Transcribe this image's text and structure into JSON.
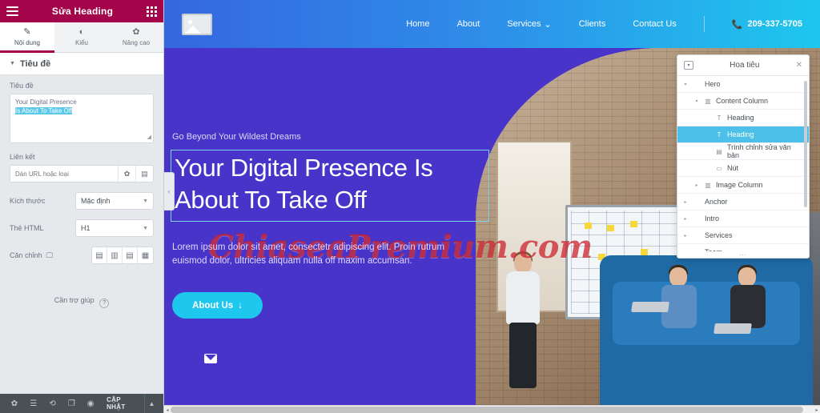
{
  "editor": {
    "header": {
      "title": "Sửa Heading",
      "menu_icon": "hamburger-icon",
      "apps_icon": "grid-icon"
    },
    "tabs": [
      {
        "label": "Nội dung",
        "icon": "pencil-icon",
        "active": true
      },
      {
        "label": "Kiểu",
        "icon": "contrast-icon",
        "active": false
      },
      {
        "label": "Nâng cao",
        "icon": "gear-icon",
        "active": false
      }
    ],
    "section": {
      "title": "Tiêu đề"
    },
    "fields": {
      "title_label": "Tiêu đề",
      "title_value_line1": "Your Digital Presence",
      "title_value_line2": "Is About To Take Off",
      "link_label": "Liên kết",
      "link_placeholder": "Dán URL hoặc loại",
      "size_label": "Kích thước",
      "size_value": "Mặc định",
      "html_tag_label": "Thẻ HTML",
      "html_tag_value": "H1",
      "align_label": "Căn chỉnh",
      "align_options": [
        "align-left",
        "align-center",
        "align-right",
        "align-justify"
      ]
    },
    "help": {
      "label": "Cần trợ giúp",
      "badge": "?"
    },
    "footer": {
      "icons": [
        "settings-icon",
        "layers-icon",
        "history-icon",
        "responsive-icon",
        "preview-eye-icon"
      ],
      "update_label": "CẬP NHẬT",
      "update_arrow": "▲"
    }
  },
  "site": {
    "logo_alt": "image-placeholder-icon",
    "nav": [
      {
        "label": "Home",
        "has_dropdown": false
      },
      {
        "label": "About",
        "has_dropdown": false
      },
      {
        "label": "Services",
        "has_dropdown": true
      },
      {
        "label": "Clients",
        "has_dropdown": false
      },
      {
        "label": "Contact Us",
        "has_dropdown": false
      }
    ],
    "phone": "209-337-5705",
    "hero": {
      "eyebrow": "Go Beyond Your Wildest Dreams",
      "heading_line1": "Your Digital Presence Is",
      "heading_line2": "About To Take Off",
      "paragraph": "Lorem ipsum dolor sit amet, consectetr adipiscing elit. Proin rutrum euismod dolor, ultricies aliquam nulla off  maxim accumsan.",
      "cta_label": "About Us",
      "cta_arrow": "↓",
      "mail_icon": "envelope-icon"
    },
    "watermark": "ChiaseaPremium.com"
  },
  "navigator": {
    "title": "Hoa tiêu",
    "dock_icon": "dock-icon",
    "close_icon": "close-icon",
    "items": [
      {
        "label": "Hero",
        "depth": 0,
        "icon": "",
        "arrow": "▾",
        "selected": false
      },
      {
        "label": "Content Column",
        "depth": 1,
        "icon": "column-icon",
        "arrow": "▾",
        "selected": false
      },
      {
        "label": "Heading",
        "depth": 2,
        "icon": "text-icon",
        "arrow": "",
        "selected": false
      },
      {
        "label": "Heading",
        "depth": 2,
        "icon": "text-icon",
        "arrow": "",
        "selected": true
      },
      {
        "label": "Trình chỉnh sửa văn bản",
        "depth": 2,
        "icon": "editor-icon",
        "arrow": "",
        "selected": false
      },
      {
        "label": "Nút",
        "depth": 2,
        "icon": "button-icon",
        "arrow": "",
        "selected": false
      },
      {
        "label": "Image Column",
        "depth": 1,
        "icon": "column-icon",
        "arrow": "▸",
        "selected": false
      },
      {
        "label": "Anchor",
        "depth": 0,
        "icon": "",
        "arrow": "▸",
        "selected": false
      },
      {
        "label": "Intro",
        "depth": 0,
        "icon": "",
        "arrow": "▸",
        "selected": false
      },
      {
        "label": "Services",
        "depth": 0,
        "icon": "",
        "arrow": "▸",
        "selected": false
      },
      {
        "label": "Team",
        "depth": 0,
        "icon": "",
        "arrow": "▸",
        "selected": false
      }
    ],
    "resize_handle": "⋯"
  },
  "colors": {
    "panel_header": "#a4054a",
    "accent_tab": "#a4054a",
    "hero_bg": "#4834c9",
    "nav_gradient_start": "#3567e0",
    "nav_gradient_end": "#1ec7ee",
    "cta": "#1ec7ee",
    "selection": "#4cc0e8",
    "footer_bar": "#495157",
    "watermark": "#c81923"
  }
}
